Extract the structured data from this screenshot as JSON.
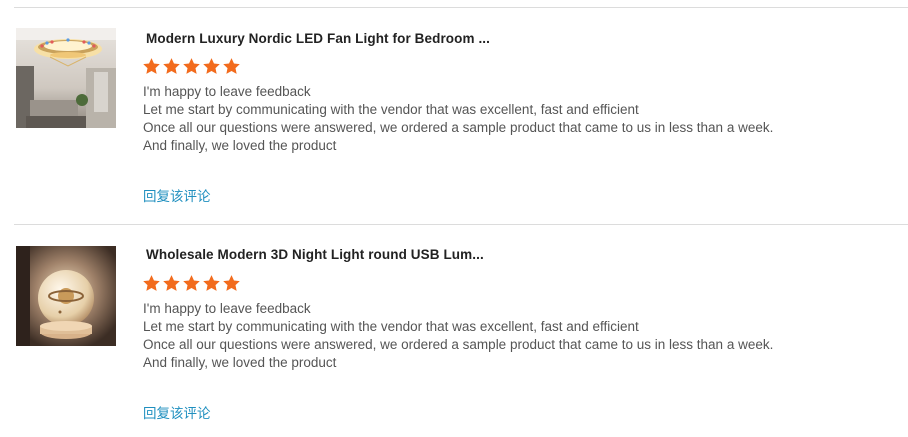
{
  "reviews": [
    {
      "product_title": "Modern Luxury Nordic LED Fan Light for Bedroom ...",
      "rating": 5,
      "lines": [
        "I'm happy to leave feedback",
        "Let me start by communicating with the vendor that was excellent, fast and efficient",
        "Once all our questions were answered, we ordered a sample product that came to us in less than a week.",
        "And finally, we loved the product"
      ],
      "reply_label": "回复该评论"
    },
    {
      "product_title": "Wholesale Modern 3D Night Light round USB Lum...",
      "rating": 5,
      "lines": [
        "I'm happy to leave feedback",
        "Let me start by communicating with the vendor that was excellent, fast and efficient",
        "Once all our questions were answered, we ordered a sample product that came to us in less than a week.",
        "And finally, we loved the product"
      ],
      "reply_label": "回复该评论"
    }
  ],
  "colors": {
    "star": "#f26b1d",
    "reply_link": "#1f8fbf",
    "divider": "#dcdcdc"
  },
  "icons": {
    "star": "star-icon"
  }
}
